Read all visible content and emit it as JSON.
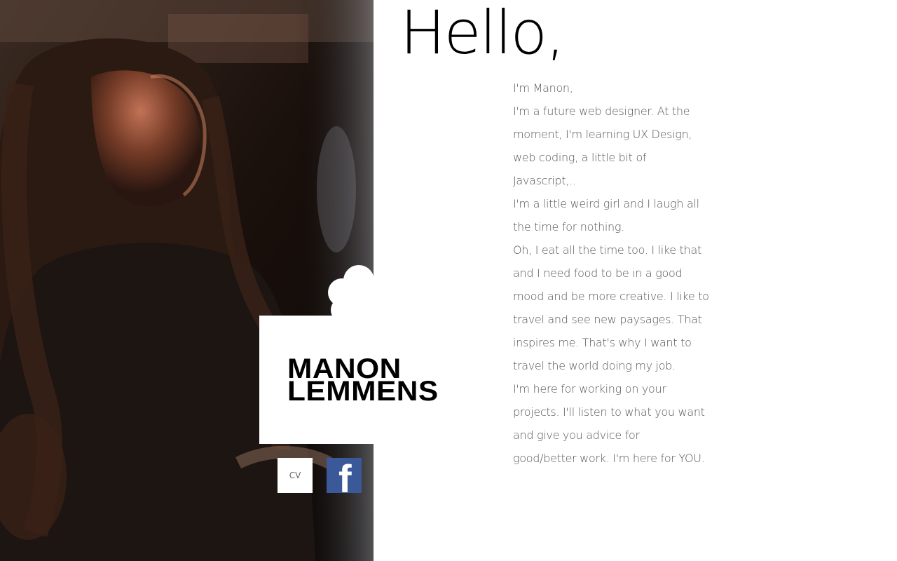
{
  "hero": {
    "photo_icon": "portrait-photo",
    "first_name": "MANON",
    "last_name": "LEMMENS"
  },
  "links": {
    "cv_label": "CV",
    "facebook_icon": "facebook-icon",
    "facebook_glyph": "f",
    "facebook_color": "#3b5998"
  },
  "intro": {
    "greeting": "Hello,",
    "bio_lines": [
      "I'm Manon,",
      "I'm a future web designer. At the",
      "moment, I'm learning UX Design,",
      "web coding, a little bit of",
      "Javascript,..",
      "I'm a little weird girl and I laugh all",
      "the time for nothing.",
      "Oh, I eat all the time too. I like that",
      "and I need food to be in a good",
      "mood and be more creative. I like to",
      "travel and see new paysages. That",
      "inspires me. That's why I want to",
      "travel the world doing my job.",
      "I'm here for working on your",
      "projects. I'll listen to what you want",
      "and give you advice for",
      "good/better work. I'm here for YOU."
    ]
  }
}
